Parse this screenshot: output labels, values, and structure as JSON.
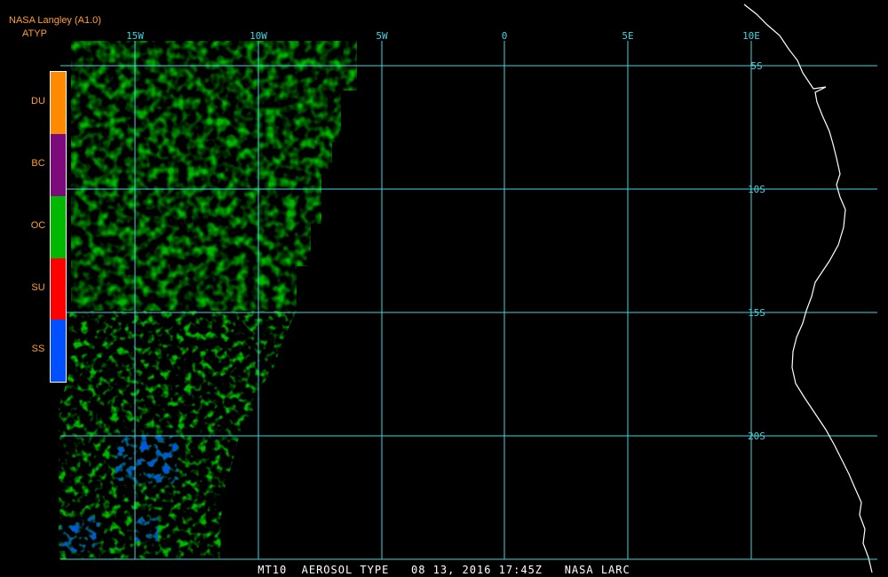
{
  "header": {
    "title": "NASA Langley (A1.0)",
    "product": "ATYP"
  },
  "legend": {
    "items": [
      {
        "label": "DU",
        "color": "#ff8a00"
      },
      {
        "label": "BC",
        "color": "#7d0a7d"
      },
      {
        "label": "OC",
        "color": "#00b800"
      },
      {
        "label": "SU",
        "color": "#ff0000"
      },
      {
        "label": "SS",
        "color": "#0050ff"
      }
    ]
  },
  "grid": {
    "color": "#3fd6e0",
    "lon_labels": [
      "15W",
      "10W",
      "5W",
      "0",
      "5E",
      "10E"
    ],
    "lat_labels": [
      "5S",
      "10S",
      "15S",
      "20S"
    ],
    "lon_range": [
      -17.8,
      15.0
    ],
    "lat_range": [
      -4.4,
      -23.9
    ]
  },
  "footer": {
    "text": "MT10  AEROSOL TYPE   08 13, 2016 17:45Z   NASA LARC"
  }
}
